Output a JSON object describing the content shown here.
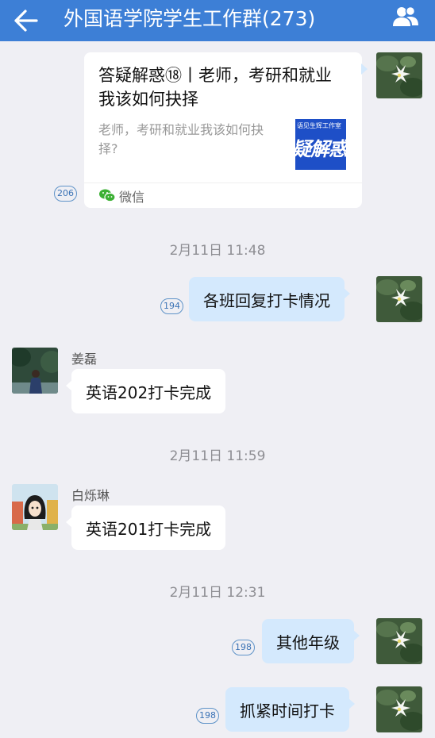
{
  "header": {
    "title": "外国语学院学生工作群(273)",
    "back_icon": "arrow-left-icon",
    "members_icon": "group-members-icon",
    "background_color": "#3d7fd6"
  },
  "messages": [
    {
      "type": "share_card",
      "side": "right",
      "title": "答疑解惑⑱丨老师，考研和就业我该如何抉择",
      "description": "老师，考研和就业我该如何抉择?",
      "thumb_top": "语见生辉工作室",
      "thumb_main": "疑解惑",
      "source": "微信",
      "read_count": "206"
    },
    {
      "type": "timestamp",
      "text": "2月11日  11:48"
    },
    {
      "type": "text",
      "side": "right",
      "text": "各班回复打卡情况",
      "read_count": "194"
    },
    {
      "type": "text",
      "side": "left",
      "sender": "姜磊",
      "text": "英语202打卡完成"
    },
    {
      "type": "timestamp",
      "text": "2月11日  11:59"
    },
    {
      "type": "text",
      "side": "left",
      "sender": "白烁琳",
      "text": "英语201打卡完成"
    },
    {
      "type": "timestamp",
      "text": "2月11日  12:31"
    },
    {
      "type": "text",
      "side": "right",
      "text": "其他年级",
      "read_count": "198"
    },
    {
      "type": "text",
      "side": "right",
      "text": "抓紧时间打卡",
      "read_count": "198"
    }
  ],
  "colors": {
    "chat_background": "#efeff4",
    "self_bubble": "#d4e9fd",
    "other_bubble": "#ffffff",
    "read_badge": "#3a72b5"
  }
}
